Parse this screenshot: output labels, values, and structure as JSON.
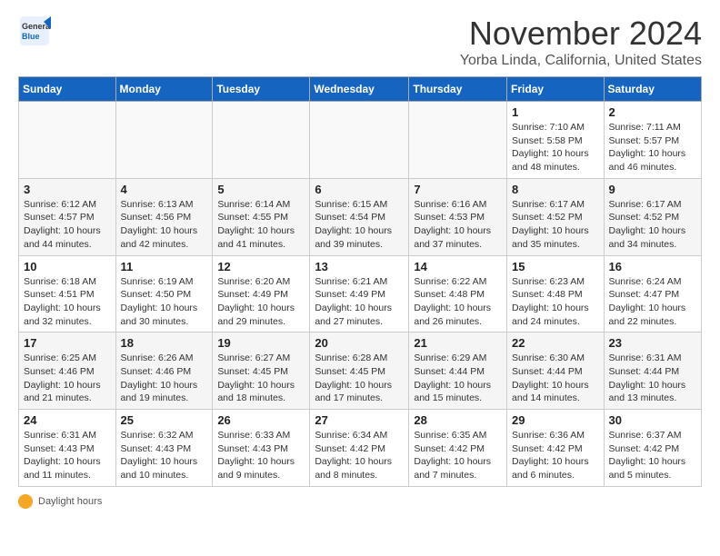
{
  "header": {
    "logo_general": "General",
    "logo_blue": "Blue",
    "month_year": "November 2024",
    "location": "Yorba Linda, California, United States"
  },
  "days_of_week": [
    "Sunday",
    "Monday",
    "Tuesday",
    "Wednesday",
    "Thursday",
    "Friday",
    "Saturday"
  ],
  "weeks": [
    [
      {
        "day": "",
        "info": ""
      },
      {
        "day": "",
        "info": ""
      },
      {
        "day": "",
        "info": ""
      },
      {
        "day": "",
        "info": ""
      },
      {
        "day": "",
        "info": ""
      },
      {
        "day": "1",
        "info": "Sunrise: 7:10 AM\nSunset: 5:58 PM\nDaylight: 10 hours and 48 minutes."
      },
      {
        "day": "2",
        "info": "Sunrise: 7:11 AM\nSunset: 5:57 PM\nDaylight: 10 hours and 46 minutes."
      }
    ],
    [
      {
        "day": "3",
        "info": "Sunrise: 6:12 AM\nSunset: 4:57 PM\nDaylight: 10 hours and 44 minutes."
      },
      {
        "day": "4",
        "info": "Sunrise: 6:13 AM\nSunset: 4:56 PM\nDaylight: 10 hours and 42 minutes."
      },
      {
        "day": "5",
        "info": "Sunrise: 6:14 AM\nSunset: 4:55 PM\nDaylight: 10 hours and 41 minutes."
      },
      {
        "day": "6",
        "info": "Sunrise: 6:15 AM\nSunset: 4:54 PM\nDaylight: 10 hours and 39 minutes."
      },
      {
        "day": "7",
        "info": "Sunrise: 6:16 AM\nSunset: 4:53 PM\nDaylight: 10 hours and 37 minutes."
      },
      {
        "day": "8",
        "info": "Sunrise: 6:17 AM\nSunset: 4:52 PM\nDaylight: 10 hours and 35 minutes."
      },
      {
        "day": "9",
        "info": "Sunrise: 6:17 AM\nSunset: 4:52 PM\nDaylight: 10 hours and 34 minutes."
      }
    ],
    [
      {
        "day": "10",
        "info": "Sunrise: 6:18 AM\nSunset: 4:51 PM\nDaylight: 10 hours and 32 minutes."
      },
      {
        "day": "11",
        "info": "Sunrise: 6:19 AM\nSunset: 4:50 PM\nDaylight: 10 hours and 30 minutes."
      },
      {
        "day": "12",
        "info": "Sunrise: 6:20 AM\nSunset: 4:49 PM\nDaylight: 10 hours and 29 minutes."
      },
      {
        "day": "13",
        "info": "Sunrise: 6:21 AM\nSunset: 4:49 PM\nDaylight: 10 hours and 27 minutes."
      },
      {
        "day": "14",
        "info": "Sunrise: 6:22 AM\nSunset: 4:48 PM\nDaylight: 10 hours and 26 minutes."
      },
      {
        "day": "15",
        "info": "Sunrise: 6:23 AM\nSunset: 4:48 PM\nDaylight: 10 hours and 24 minutes."
      },
      {
        "day": "16",
        "info": "Sunrise: 6:24 AM\nSunset: 4:47 PM\nDaylight: 10 hours and 22 minutes."
      }
    ],
    [
      {
        "day": "17",
        "info": "Sunrise: 6:25 AM\nSunset: 4:46 PM\nDaylight: 10 hours and 21 minutes."
      },
      {
        "day": "18",
        "info": "Sunrise: 6:26 AM\nSunset: 4:46 PM\nDaylight: 10 hours and 19 minutes."
      },
      {
        "day": "19",
        "info": "Sunrise: 6:27 AM\nSunset: 4:45 PM\nDaylight: 10 hours and 18 minutes."
      },
      {
        "day": "20",
        "info": "Sunrise: 6:28 AM\nSunset: 4:45 PM\nDaylight: 10 hours and 17 minutes."
      },
      {
        "day": "21",
        "info": "Sunrise: 6:29 AM\nSunset: 4:44 PM\nDaylight: 10 hours and 15 minutes."
      },
      {
        "day": "22",
        "info": "Sunrise: 6:30 AM\nSunset: 4:44 PM\nDaylight: 10 hours and 14 minutes."
      },
      {
        "day": "23",
        "info": "Sunrise: 6:31 AM\nSunset: 4:44 PM\nDaylight: 10 hours and 13 minutes."
      }
    ],
    [
      {
        "day": "24",
        "info": "Sunrise: 6:31 AM\nSunset: 4:43 PM\nDaylight: 10 hours and 11 minutes."
      },
      {
        "day": "25",
        "info": "Sunrise: 6:32 AM\nSunset: 4:43 PM\nDaylight: 10 hours and 10 minutes."
      },
      {
        "day": "26",
        "info": "Sunrise: 6:33 AM\nSunset: 4:43 PM\nDaylight: 10 hours and 9 minutes."
      },
      {
        "day": "27",
        "info": "Sunrise: 6:34 AM\nSunset: 4:42 PM\nDaylight: 10 hours and 8 minutes."
      },
      {
        "day": "28",
        "info": "Sunrise: 6:35 AM\nSunset: 4:42 PM\nDaylight: 10 hours and 7 minutes."
      },
      {
        "day": "29",
        "info": "Sunrise: 6:36 AM\nSunset: 4:42 PM\nDaylight: 10 hours and 6 minutes."
      },
      {
        "day": "30",
        "info": "Sunrise: 6:37 AM\nSunset: 4:42 PM\nDaylight: 10 hours and 5 minutes."
      }
    ]
  ],
  "footer": {
    "daylight_label": "Daylight hours"
  }
}
